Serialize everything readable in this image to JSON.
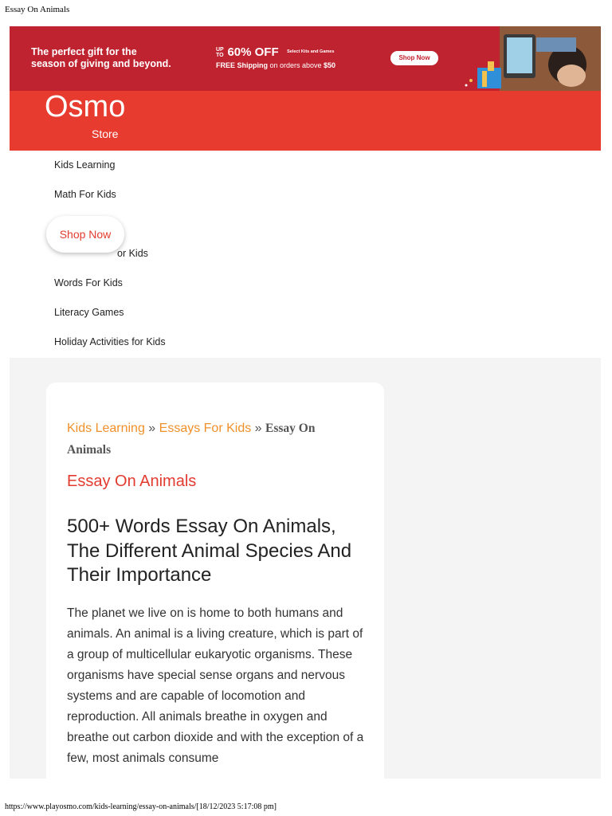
{
  "print": {
    "page_title": "Essay On Animals",
    "footer": "https://www.playosmo.com/kids-learning/essay-on-animals/[18/12/2023 5:17:08 pm]"
  },
  "promo": {
    "line1": "The perfect gift for the",
    "line2": "season of giving and beyond.",
    "upto_top": "UP",
    "upto_bottom": "TO",
    "percent": "60% OFF",
    "select_text": "Select Kits and Games",
    "shipping_bold": "FREE Shipping",
    "shipping_rest": " on orders above ",
    "shipping_amount": "$50",
    "button_label": "Shop Now"
  },
  "header": {
    "logo_text": "Osmo",
    "store_label": "Store"
  },
  "nav": {
    "items": [
      "Kids Learning",
      "Math For Kids",
      "Words For Kids",
      "Literacy Games",
      "Holiday Activities for Kids"
    ],
    "partial_item": "or Kids",
    "shop_now": "Shop Now"
  },
  "breadcrumb": {
    "link1": "Kids Learning",
    "sep1": " » ",
    "link2": "Essays For Kids",
    "sep2": " » ",
    "current": "Essay On Animals"
  },
  "article": {
    "heading": "Essay On Animals",
    "title": "500+ Words Essay On Animals, The Different Animal Species And Their Importance",
    "body": "The planet we live on is home to both humans and animals. An animal is a living creature, which is part of a group of multicellular eukaryotic organisms. These organisms have special sense organs and nervous systems and are capable of locomotion and reproduction. All animals breathe in oxygen and breathe out carbon dioxide and with the exception of a few, most animals consume"
  },
  "colors": {
    "promo_bg": "#bf2330",
    "brand_red": "#e73b2f",
    "link_orange": "#f0902a",
    "page_bg": "#f4f4f4"
  }
}
